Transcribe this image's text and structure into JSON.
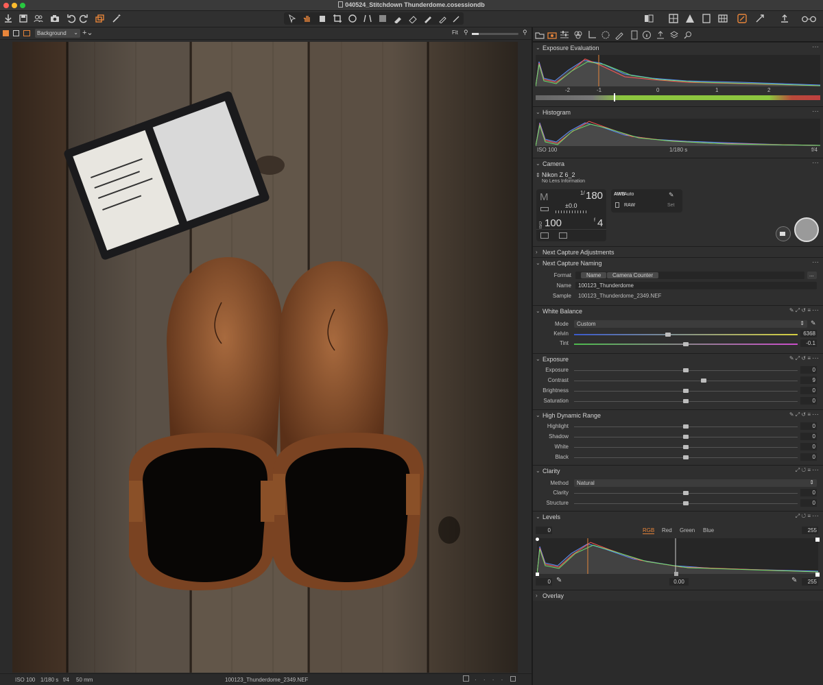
{
  "app": {
    "title": "040524_Stitchdown Thunderdome.cosessiondb"
  },
  "viewbar": {
    "layer": "Background",
    "zoom_label": "Fit"
  },
  "statusbar": {
    "iso": "ISO 100",
    "shutter": "1/180 s",
    "aperture": "f/4",
    "focal": "50 mm",
    "filename": "100123_Thunderdome_2349.NEF"
  },
  "exposure_eval": {
    "title": "Exposure Evaluation",
    "scale": [
      "-2",
      "-1",
      "0",
      "1",
      "2"
    ]
  },
  "histogram": {
    "title": "Histogram",
    "iso": "ISO 100",
    "shutter": "1/180 s",
    "aperture": "f/4"
  },
  "camera": {
    "title": "Camera",
    "model": "Nikon Z 6_2",
    "lens": "No Lens Information",
    "mode": "M",
    "shutter_prefix": "1/",
    "shutter": "180",
    "ev": "±0.0",
    "iso_label": "ISO",
    "iso": "100",
    "aperture_prefix": "f",
    "aperture": "4",
    "wb_icon": "AWB",
    "wb": "Auto",
    "format": "RAW",
    "set": "Set"
  },
  "next_capture_adjustments": {
    "title": "Next Capture Adjustments"
  },
  "next_capture_naming": {
    "title": "Next Capture Naming",
    "format_label": "Format",
    "tokens": [
      "Name",
      "Camera Counter"
    ],
    "more": "...",
    "name_label": "Name",
    "name": "100123_Thunderdome",
    "sample_label": "Sample",
    "sample": "100123_Thunderdome_2349.NEF"
  },
  "white_balance": {
    "title": "White Balance",
    "mode_label": "Mode",
    "mode": "Custom",
    "kelvin_label": "Kelvin",
    "kelvin": "6368",
    "kelvin_pos": 0.42,
    "tint_label": "Tint",
    "tint": "-0.1",
    "tint_pos": 0.5
  },
  "exposure": {
    "title": "Exposure",
    "sliders": [
      {
        "label": "Exposure",
        "value": "0",
        "pos": 0.5
      },
      {
        "label": "Contrast",
        "value": "9",
        "pos": 0.58
      },
      {
        "label": "Brightness",
        "value": "0",
        "pos": 0.5
      },
      {
        "label": "Saturation",
        "value": "0",
        "pos": 0.5
      }
    ]
  },
  "hdr": {
    "title": "High Dynamic Range",
    "sliders": [
      {
        "label": "Highlight",
        "value": "0",
        "pos": 0.5
      },
      {
        "label": "Shadow",
        "value": "0",
        "pos": 0.5
      },
      {
        "label": "White",
        "value": "0",
        "pos": 0.5
      },
      {
        "label": "Black",
        "value": "0",
        "pos": 0.5
      }
    ]
  },
  "clarity": {
    "title": "Clarity",
    "method_label": "Method",
    "method": "Natural",
    "sliders": [
      {
        "label": "Clarity",
        "value": "0",
        "pos": 0.5
      },
      {
        "label": "Structure",
        "value": "0",
        "pos": 0.5
      }
    ]
  },
  "levels": {
    "title": "Levels",
    "in_low": "0",
    "in_high": "255",
    "channels": [
      "RGB",
      "Red",
      "Green",
      "Blue"
    ],
    "out_low": "0",
    "mid": "0.00",
    "out_high": "255"
  },
  "overlay": {
    "title": "Overlay"
  },
  "colors": {
    "accent": "#e8853a",
    "bg": "#2b2b2b",
    "panel": "#2f2f2f"
  }
}
